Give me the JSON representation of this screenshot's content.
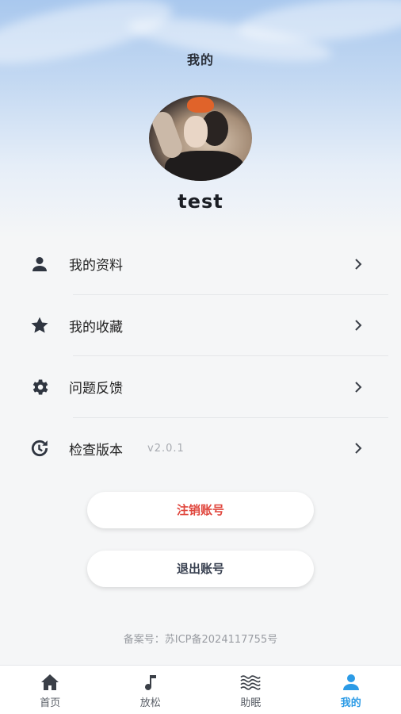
{
  "header": {
    "title": "我的"
  },
  "profile": {
    "username": "test"
  },
  "menu": [
    {
      "label": "我的资料",
      "icon": "person-icon"
    },
    {
      "label": "我的收藏",
      "icon": "star-icon"
    },
    {
      "label": "问题反馈",
      "icon": "gear-icon"
    },
    {
      "label": "检查版本",
      "icon": "history-icon",
      "extra": "v2.0.1"
    }
  ],
  "buttons": {
    "cancel_account": "注销账号",
    "logout": "退出账号"
  },
  "footer": {
    "icp": "备案号：苏ICP备2024117755号"
  },
  "tabbar": [
    {
      "label": "首页",
      "icon": "home-icon"
    },
    {
      "label": "放松",
      "icon": "music-note-icon"
    },
    {
      "label": "助眠",
      "icon": "waves-icon"
    },
    {
      "label": "我的",
      "icon": "person-icon",
      "active": true
    }
  ],
  "colors": {
    "accent": "#2c9be6",
    "danger": "#e0473e",
    "icon": "#2f3540"
  }
}
